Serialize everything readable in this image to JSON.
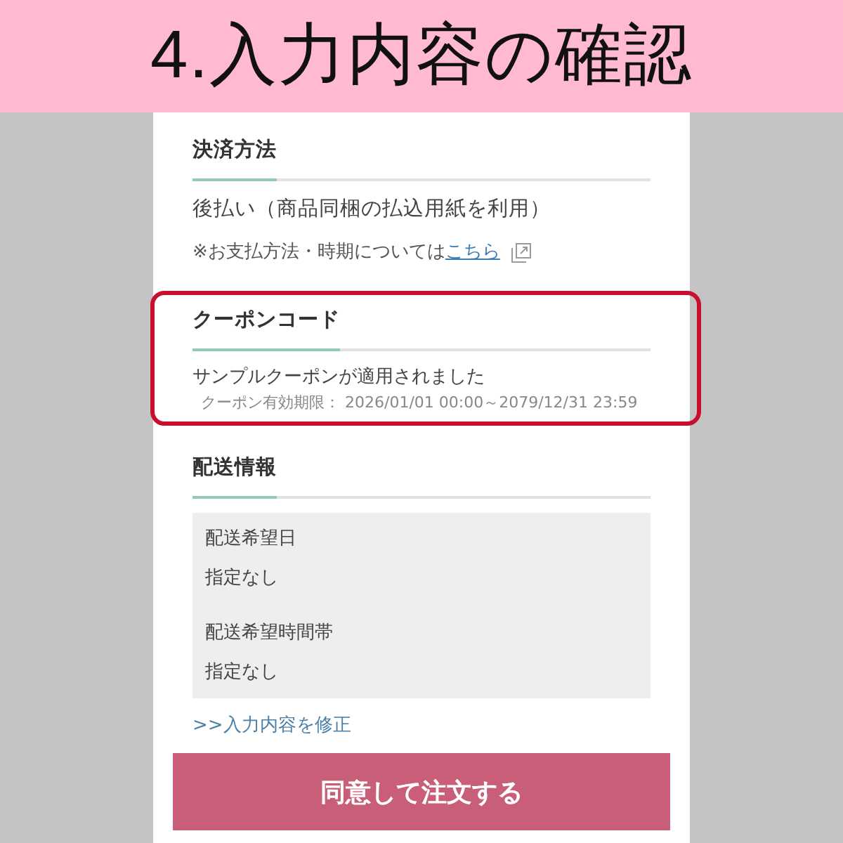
{
  "banner": {
    "title": "4.入力内容の確認"
  },
  "sections": [
    {
      "kind": "payment",
      "heading": "決済方法",
      "highlighted": false,
      "value": "後払い（商品同梱の払込用紙を利用）",
      "note": {
        "text": "※お支払方法・時期については",
        "link": "こちら"
      }
    },
    {
      "kind": "coupon",
      "heading": "クーポンコード",
      "highlighted": true,
      "message": "サンプルクーポンが適用されました",
      "validity": "クーポン有効期限： 2026/01/01 00:00～2079/12/31 23:59"
    },
    {
      "kind": "delivery",
      "heading": "配送情報",
      "highlighted": false,
      "fields": [
        {
          "label": "配送希望日",
          "value": "指定なし"
        },
        {
          "label": "配送希望時間帯",
          "value": "指定なし"
        }
      ]
    }
  ],
  "edit_link": ">>入力内容を修正",
  "submit_button": "同意して注文する"
}
